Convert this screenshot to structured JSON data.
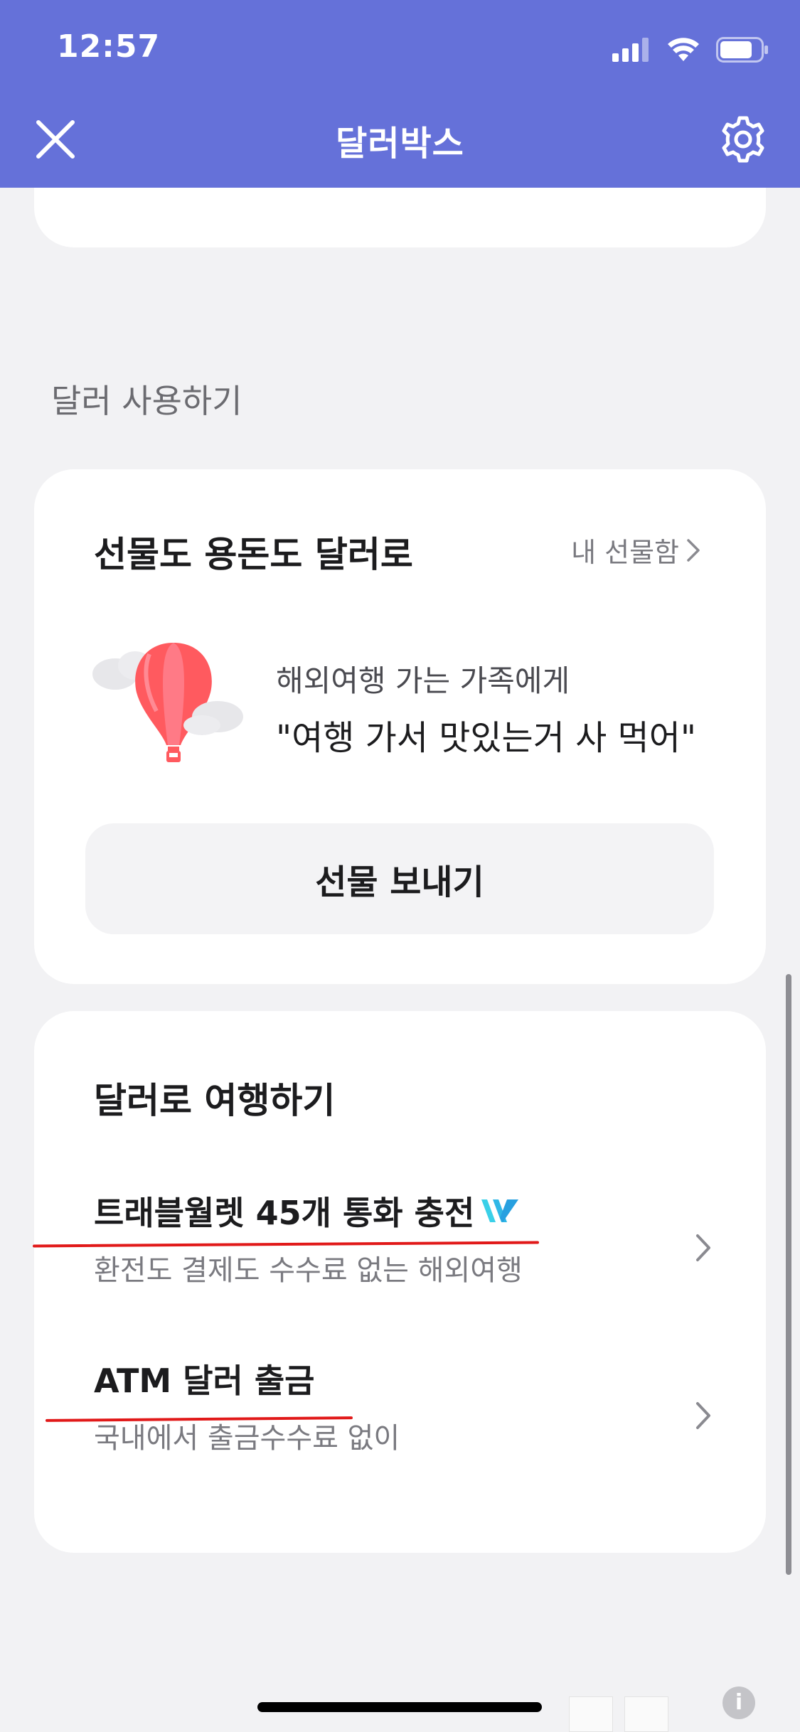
{
  "status_bar": {
    "time": "12:57"
  },
  "nav": {
    "title": "달러박스"
  },
  "section_label": "달러 사용하기",
  "gift_card": {
    "title": "선물도 용돈도 달러로",
    "link": "내 선물함",
    "line1": "해외여행 가는 가족에게",
    "line2": "\"여행 가서 맛있는거 사 먹어\"",
    "button": "선물 보내기"
  },
  "travel_card": {
    "title": "달러로 여행하기",
    "items": [
      {
        "title": "트래블월렛 45개 통화 충전",
        "subtitle": "환전도 결제도 수수료 없는 해외여행"
      },
      {
        "title": "ATM 달러 출금",
        "subtitle": "국내에서 출금수수료 없이"
      }
    ]
  },
  "colors": {
    "header": "#6571d9",
    "underline": "#e11919",
    "balloon": "#ff5a5f"
  }
}
